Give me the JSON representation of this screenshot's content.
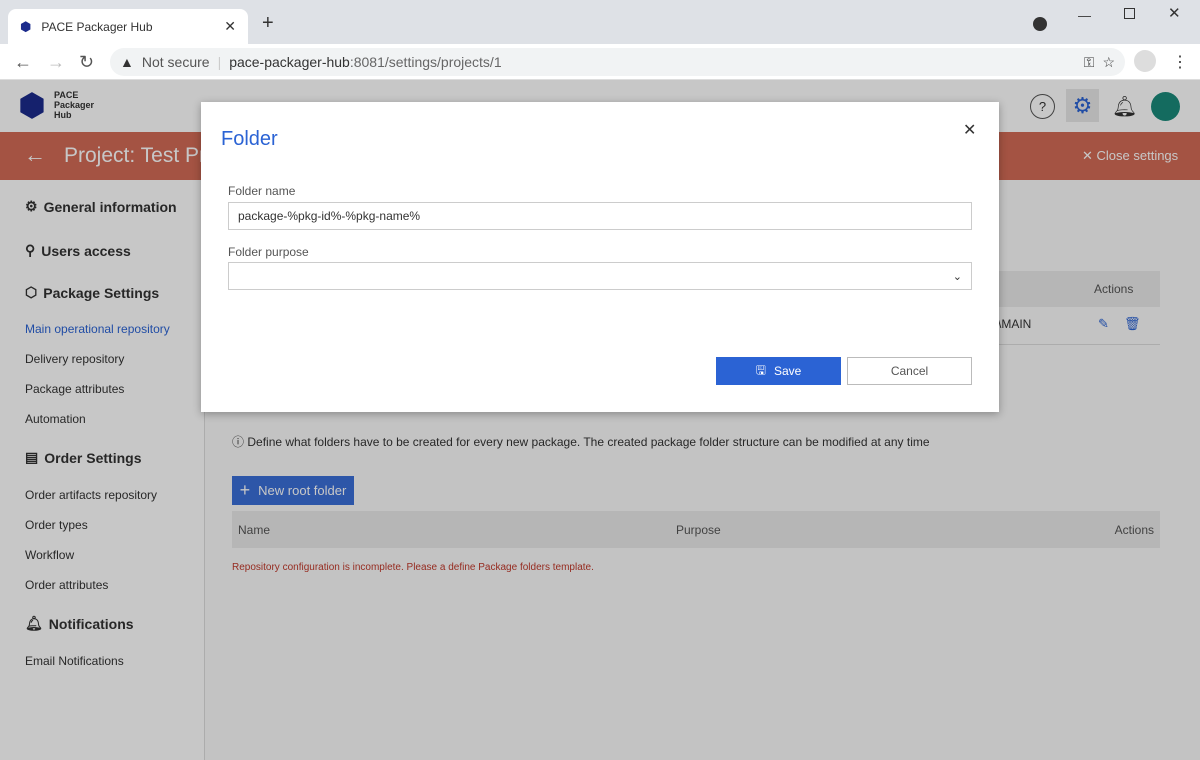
{
  "browser": {
    "tab_title": "PACE Packager Hub",
    "not_secure": "Not secure",
    "url_host": "pace-packager-hub",
    "url_rest": ":8081/settings/projects/1"
  },
  "logo": {
    "line1": "PACE",
    "line2": "Packager",
    "line3": "Hub"
  },
  "banner": {
    "title": "Project: Test Pr",
    "close_settings": "Close settings"
  },
  "sidebar": {
    "general": "General information",
    "users": "Users access",
    "package_settings": "Package Settings",
    "package_items": [
      "Main operational repository",
      "Delivery repository",
      "Package attributes",
      "Automation"
    ],
    "order_settings": "Order Settings",
    "order_items": [
      "Order artifacts repository",
      "Order types",
      "Workflow",
      "Order attributes"
    ],
    "notifications": "Notifications",
    "notification_items": [
      "Email Notifications"
    ]
  },
  "main": {
    "table1_actions": "Actions",
    "row_value": "\\MAIN",
    "info": "Define what folders have to be created for every new package. The created package folder structure can be modified at any time",
    "new_root_folder": "New root folder",
    "columns": [
      "Name",
      "Purpose",
      "Actions"
    ],
    "error": "Repository configuration is incomplete. Please a define Package folders template."
  },
  "modal": {
    "title": "Folder",
    "folder_name_label": "Folder name",
    "folder_name_value": "package-%pkg-id%-%pkg-name%",
    "folder_purpose_label": "Folder purpose",
    "folder_purpose_value": "",
    "save": "Save",
    "cancel": "Cancel"
  },
  "colors": {
    "accent": "#2b63d4",
    "banner": "#d36b57",
    "error": "#c0392b"
  }
}
